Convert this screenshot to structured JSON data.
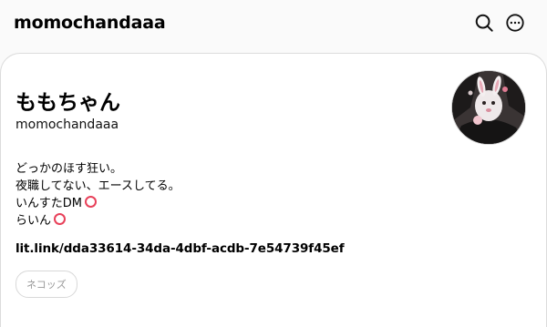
{
  "header": {
    "title": "momochandaaa",
    "search_icon": "search-icon",
    "more_icon": "more-icon"
  },
  "profile": {
    "display_name": "ももちゃん",
    "username": "momochandaaa",
    "bio": [
      "どっかのほす狂い。",
      "夜職してない、エースしてる。",
      "いんすたDM",
      "らいん"
    ],
    "bio_marker_icon": "red-circle-icon",
    "bio_marker_color": "#e8415a",
    "link": "lit.link/dda33614-34da-4dbf-acdb-7e54739f45ef",
    "tag": "ネコッズ"
  }
}
